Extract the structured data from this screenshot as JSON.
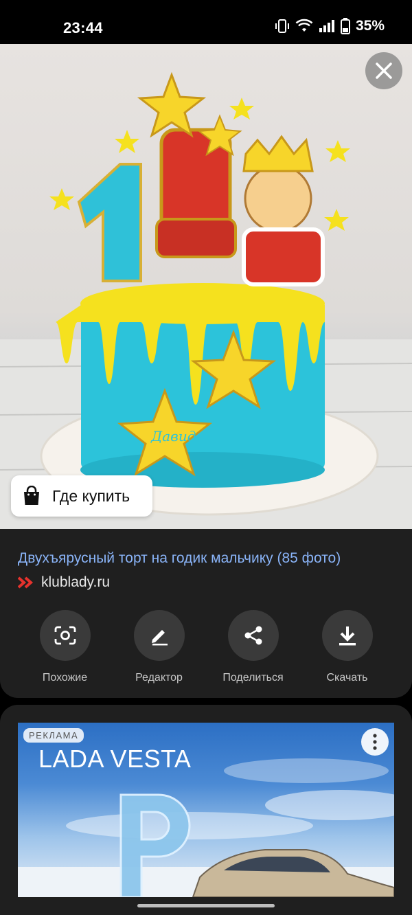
{
  "status_bar": {
    "time": "23:44",
    "battery_percent": "35%",
    "icons": [
      "vibrate-icon",
      "wifi-icon",
      "signal-icon",
      "battery-icon"
    ]
  },
  "image_viewer": {
    "image_subject": "cake",
    "cake_topper_text": "Давид",
    "close_icon": "close-icon",
    "buy_chip": {
      "icon": "shopping-bag-icon",
      "label": "Где купить"
    }
  },
  "result": {
    "title": "Двухъярусный торт на годик мальчику (85 фото)",
    "source": "klublady.ru",
    "source_icon": "klublady-logo-icon"
  },
  "actions": [
    {
      "icon": "lens-search-icon",
      "label": "Похожие"
    },
    {
      "icon": "pencil-icon",
      "label": "Редактор"
    },
    {
      "icon": "share-icon",
      "label": "Поделиться"
    },
    {
      "icon": "download-icon",
      "label": "Скачать"
    }
  ],
  "ad": {
    "badge": "РЕКЛАМА",
    "headline": "LADA VESTA",
    "menu_icon": "more-vert-icon"
  },
  "colors": {
    "link_blue": "#8ab4f8",
    "card_bg": "#1f1f1f",
    "button_bg": "#3a3a3a",
    "source_logo": "#e5322d"
  }
}
